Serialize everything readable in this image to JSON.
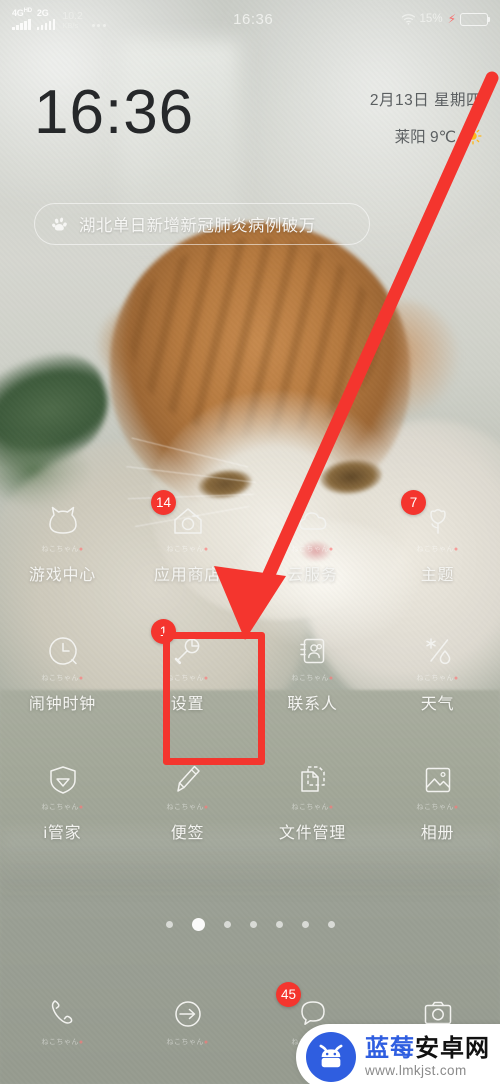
{
  "statusbar": {
    "net1_label": "4G",
    "net1_sup": "HD",
    "net2_label": "2G",
    "speed_value": "10.2",
    "speed_unit": "KB/s",
    "time": "16:36",
    "battery_percent": "15%",
    "battery_level": 15,
    "wifi_icon": "wifi-icon",
    "charging_icon": "lightning-bolt-icon",
    "more_icon": "more-dots-icon"
  },
  "clock_widget": {
    "time": "16:36",
    "date": "2月13日 星期四",
    "weather": "莱阳 9℃",
    "weather_icon": "sun-icon"
  },
  "news": {
    "icon": "baidu-paw-icon",
    "headline": "湖北单日新增新冠肺炎病例破万"
  },
  "apps": {
    "sub_text": "ねこちゃん",
    "rows": [
      [
        {
          "label": "游戏中心",
          "icon": "cat-head-icon",
          "badge": ""
        },
        {
          "label": "应用商店",
          "icon": "app-store-house-icon",
          "badge": "14"
        },
        {
          "label": "云服务",
          "icon": "cloud-icon",
          "badge": ""
        },
        {
          "label": "主题",
          "icon": "flower-theme-icon",
          "badge": "7"
        }
      ],
      [
        {
          "label": "闹钟时钟",
          "icon": "clock-icon",
          "badge": ""
        },
        {
          "label": "设置",
          "icon": "wrench-settings-icon",
          "badge": "1"
        },
        {
          "label": "联系人",
          "icon": "contacts-book-icon",
          "badge": ""
        },
        {
          "label": "天气",
          "icon": "weather-snow-rain-icon",
          "badge": ""
        }
      ],
      [
        {
          "label": "i管家",
          "icon": "shield-icon",
          "badge": ""
        },
        {
          "label": "便签",
          "icon": "pencil-note-icon",
          "badge": ""
        },
        {
          "label": "文件管理",
          "icon": "file-manager-icon",
          "badge": ""
        },
        {
          "label": "相册",
          "icon": "photo-album-icon",
          "badge": ""
        }
      ]
    ]
  },
  "pager": {
    "count": 7,
    "active_index": 1
  },
  "dock": [
    {
      "label": "",
      "icon": "phone-icon",
      "badge": ""
    },
    {
      "label": "",
      "icon": "browser-arrow-icon",
      "badge": ""
    },
    {
      "label": "",
      "icon": "message-bubble-icon",
      "badge": "45"
    },
    {
      "label": "",
      "icon": "camera-icon",
      "badge": ""
    }
  ],
  "annotation": {
    "highlight_target": "设置",
    "arrow_color": "#f4352e",
    "box_color": "#f4352e"
  },
  "watermark": {
    "name_chars": [
      "蓝",
      "莓",
      "安",
      "卓",
      "网"
    ],
    "url": "www.lmkjst.com",
    "logo_icon": "android-robot-icon"
  },
  "colors": {
    "badge_red": "#f4352e",
    "annotation_red": "#f4352e",
    "brand_blue": "#2f5ee0"
  }
}
